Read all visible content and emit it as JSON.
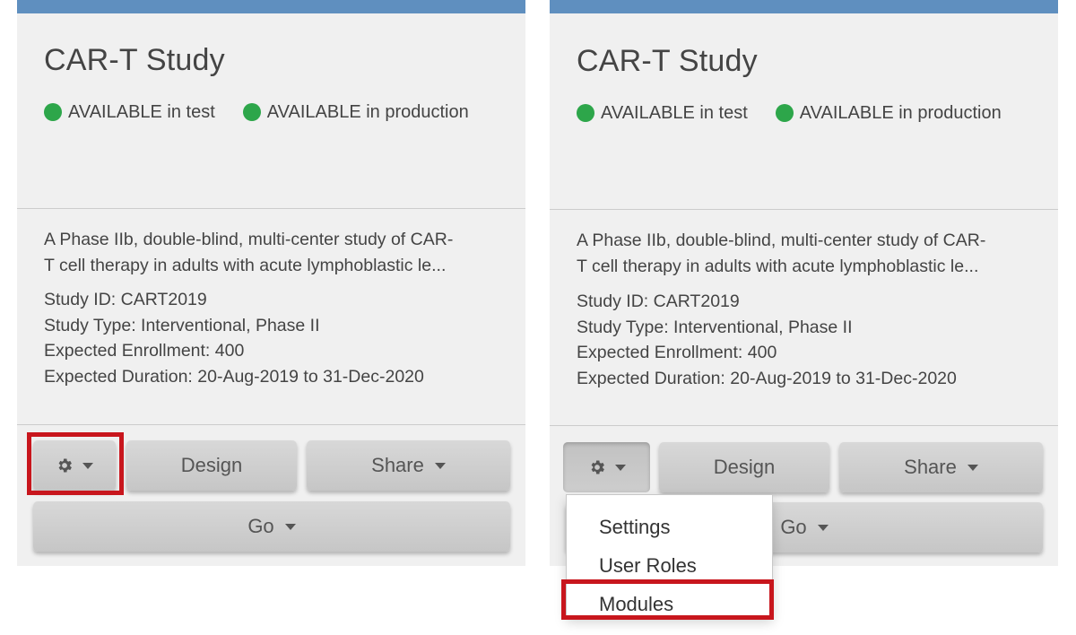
{
  "colors": {
    "card_background": "#f0f0f0",
    "top_bar": "#5f8fbf",
    "status_available": "#2da64a",
    "highlight": "#c8161d"
  },
  "cards": [
    {
      "title": "CAR-T Study",
      "status": [
        {
          "label": "AVAILABLE in test",
          "icon": "green-dot-icon"
        },
        {
          "label": "AVAILABLE in production",
          "icon": "green-dot-icon"
        }
      ],
      "description_line1": "A Phase IIb, double-blind, multi-center study of CAR-",
      "description_line2": "T cell therapy in adults with acute lymphoblastic le...",
      "study_id": "Study ID: CART2019",
      "study_type": "Study Type: Interventional, Phase II",
      "expected_enrollment": "Expected Enrollment: 400",
      "expected_duration": "Expected Duration: 20-Aug-2019 to 31-Dec-2020",
      "buttons": {
        "settings_icon": "gear-icon",
        "design": "Design",
        "share": "Share",
        "go": "Go"
      },
      "settings_button_highlighted": true
    },
    {
      "title": "CAR-T Study",
      "status": [
        {
          "label": "AVAILABLE in test",
          "icon": "green-dot-icon"
        },
        {
          "label": "AVAILABLE in production",
          "icon": "green-dot-icon"
        }
      ],
      "description_line1": "A Phase IIb, double-blind, multi-center study of CAR-",
      "description_line2": "T cell therapy in adults with acute lymphoblastic le...",
      "study_id": "Study ID: CART2019",
      "study_type": "Study Type: Interventional, Phase II",
      "expected_enrollment": "Expected Enrollment: 400",
      "expected_duration": "Expected Duration: 20-Aug-2019 to 31-Dec-2020",
      "buttons": {
        "settings_icon": "gear-icon",
        "design": "Design",
        "share": "Share",
        "go": "Go"
      },
      "settings_menu": {
        "open": true,
        "items": [
          "Settings",
          "User Roles",
          "Modules"
        ],
        "highlighted_item": "Modules"
      }
    }
  ]
}
